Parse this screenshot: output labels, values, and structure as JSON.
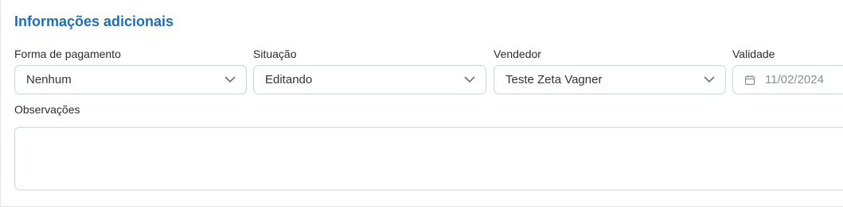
{
  "section": {
    "title": "Informações adicionais"
  },
  "fields": {
    "payment": {
      "label": "Forma de pagamento",
      "value": "Nenhum"
    },
    "status": {
      "label": "Situação",
      "value": "Editando"
    },
    "seller": {
      "label": "Vendedor",
      "value": "Teste Zeta Vagner"
    },
    "validity": {
      "label": "Validade",
      "value": "11/02/2024"
    }
  },
  "notes": {
    "label": "Observações",
    "value": ""
  },
  "colors": {
    "accent": "#1f6db2",
    "border": "#cfd4da"
  },
  "icons": {
    "dropdown": "chevron-down-icon",
    "date": "calendar-icon"
  }
}
